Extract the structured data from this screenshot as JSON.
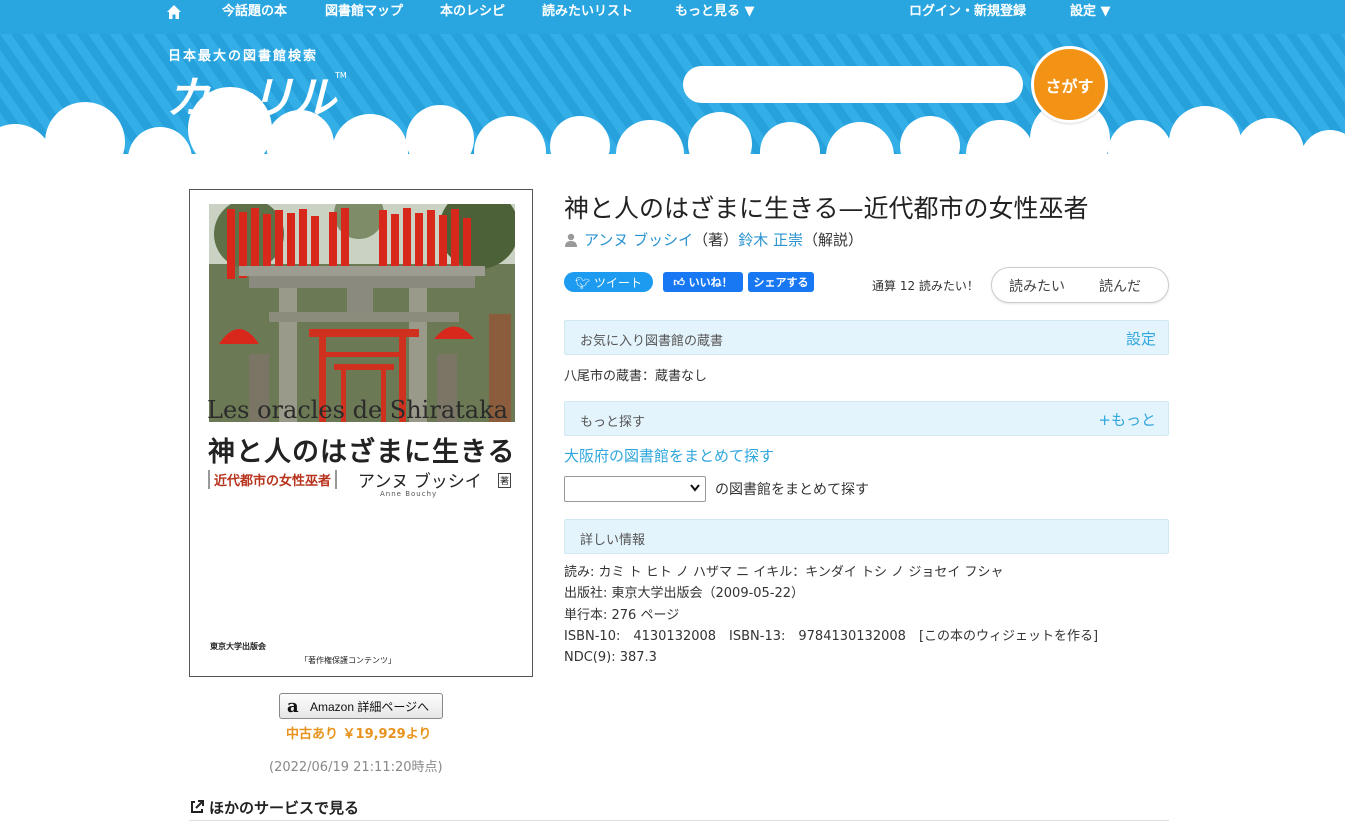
{
  "nav": {
    "items": [
      "今話題の本",
      "図書館マップ",
      "本のレシピ",
      "読みたいリスト",
      "もっと見る ▼",
      "ログイン・新規登録",
      "設定 ▼"
    ]
  },
  "header": {
    "logo_sub": "日本最大の図書館検索",
    "logo_main": "カーリル",
    "logo_tm": "TM",
    "search_placeholder": "",
    "search_button": "さがす"
  },
  "cover": {
    "title_fr": "Les oracles de Shirataka",
    "title_jp": "神と人のはざまに生きる",
    "subtitle": "近代都市の女性巫者",
    "author": "アンヌ ブッシイ",
    "author_role": "著",
    "author_en": "Anne Bouchy",
    "publisher": "東京大学出版会",
    "notice": "「著作権保護コンテンツ」"
  },
  "amazon": {
    "button_label": "Amazon 詳細ページへ",
    "used_price": "中古あり ￥19,929より",
    "timestamp": "(2022/06/19 21:11:20時点)"
  },
  "other_services": "ほかのサービスで見る",
  "book": {
    "title": "神と人のはざまに生きる—近代都市の女性巫者",
    "authors": [
      {
        "name": "アンヌ ブッシイ",
        "role": "（著）"
      },
      {
        "name": "鈴木 正崇",
        "role": "（解説）"
      }
    ]
  },
  "social": {
    "tweet": "ツイート",
    "like": "いいね！",
    "share": "シェアする"
  },
  "want": {
    "count_text": "通算 12 読みたい！",
    "want_button": "読みたい",
    "read_button": "読んだ"
  },
  "favorites": {
    "label": "お気に入り図書館の蔵書",
    "action": "設定",
    "holdings": "八尾市の蔵書：蔵書なし"
  },
  "more": {
    "label": "もっと探す",
    "action": "+もっと",
    "osaka_link": "大阪府の図書館をまとめて探す",
    "select_value": "",
    "suffix": "の図書館をまとめて探す"
  },
  "details": {
    "label": "詳しい情報",
    "reading": "読み: カミ ト ヒト ノ ハザマ ニ イキル：キンダイ トシ ノ ジョセイ フシャ",
    "publisher": "出版社: 東京大学出版会（2009-05-22）",
    "format": "単行本: 276 ページ",
    "isbn_line": "ISBN-10:　4130132008　ISBN-13:　9784130132008",
    "widget": "[この本のウィジェットを作る]",
    "ndc": "NDC(9): 387.3"
  },
  "colors": {
    "nav_blue": "#29a6e0",
    "accent_orange": "#f39315",
    "link_blue": "#2fa6dc",
    "twitter": "#1d9bf0",
    "facebook": "#1877f2"
  }
}
